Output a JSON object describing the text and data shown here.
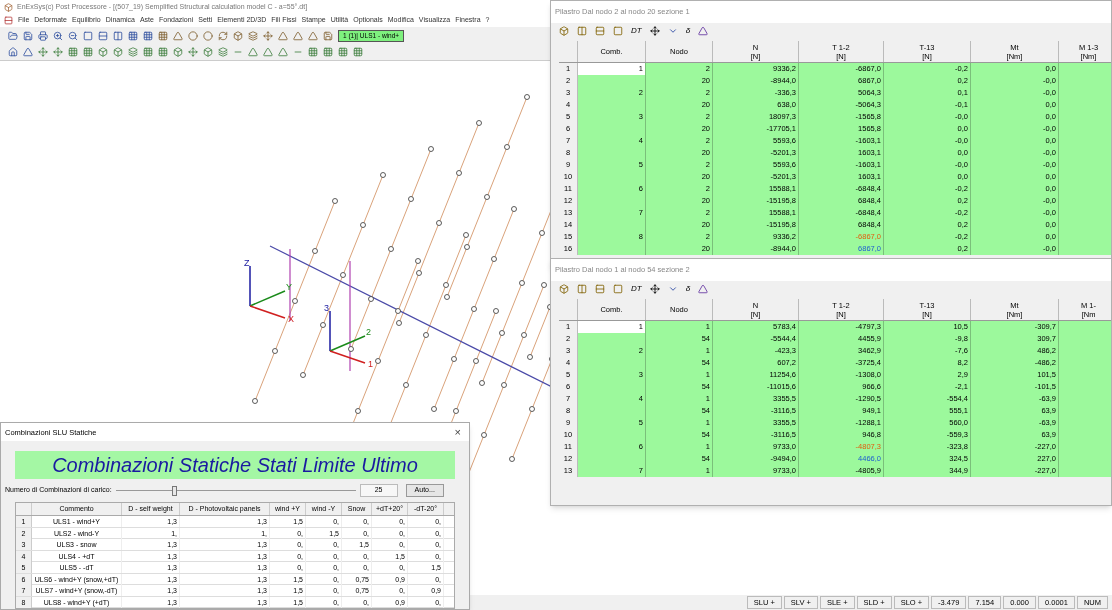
{
  "window": {
    "title": "EnExSys(c) Post Processore - [(507_19) Semplified Structural calculation model C - a=55°.dt]"
  },
  "menu": [
    "File",
    "Deformate",
    "Equilibrio",
    "Dinamica",
    "Aste",
    "Fondazioni",
    "Setti",
    "Elementi 2D/3D",
    "Fili Fissi",
    "Stampe",
    "Utilità",
    "Optionals",
    "Modifica",
    "Visualizza",
    "Finestra",
    "?"
  ],
  "combo_select": {
    "value": "1 (1)| ULS1 - wind+"
  },
  "axes_labels": [
    "Z",
    "Y",
    "X",
    "3",
    "2",
    "1"
  ],
  "result_windows": [
    {
      "title": "Pilastro Dal nodo 2 al nodo 20  sezione 1",
      "toolbar_texts": [
        "DT",
        "δ"
      ],
      "columns": [
        {
          "label": "Comb."
        },
        {
          "label": "Nodo"
        },
        {
          "label": "N",
          "unit": "[N]"
        },
        {
          "label": "T 1-2",
          "unit": "[N]"
        },
        {
          "label": "T-13",
          "unit": "[N]"
        },
        {
          "label": "Mt",
          "unit": "[Nm]"
        },
        {
          "label": "M 1-3",
          "unit": "[Nm]"
        }
      ],
      "rows": [
        {
          "num": "1",
          "cells": [
            "1",
            "2",
            "9336,2",
            "-6867,0",
            "-0,2",
            "0,0"
          ],
          "min": false,
          "max": false,
          "selected": true
        },
        {
          "num": "2",
          "cells": [
            "",
            "20",
            "-8944,0",
            "6867,0",
            "0,2",
            "-0,0"
          ],
          "min": false,
          "max": false,
          "selected": false
        },
        {
          "num": "3",
          "cells": [
            "2",
            "2",
            "-336,3",
            "5064,3",
            "0,1",
            "-0,0"
          ],
          "min": false,
          "max": false,
          "selected": false
        },
        {
          "num": "4",
          "cells": [
            "",
            "20",
            "638,0",
            "-5064,3",
            "-0,1",
            "0,0"
          ],
          "min": false,
          "max": false,
          "selected": false
        },
        {
          "num": "5",
          "cells": [
            "3",
            "2",
            "18097,3",
            "-1565,8",
            "-0,0",
            "0,0"
          ],
          "min": false,
          "max": false,
          "selected": false
        },
        {
          "num": "6",
          "cells": [
            "",
            "20",
            "-17705,1",
            "1565,8",
            "0,0",
            "-0,0"
          ],
          "min": false,
          "max": false,
          "selected": false
        },
        {
          "num": "7",
          "cells": [
            "4",
            "2",
            "5593,6",
            "-1603,1",
            "-0,0",
            "0,0"
          ],
          "min": false,
          "max": false,
          "selected": false
        },
        {
          "num": "8",
          "cells": [
            "",
            "20",
            "-5201,3",
            "1603,1",
            "0,0",
            "-0,0"
          ],
          "min": false,
          "max": false,
          "selected": false
        },
        {
          "num": "9",
          "cells": [
            "5",
            "2",
            "5593,6",
            "-1603,1",
            "-0,0",
            "-0,0"
          ],
          "min": false,
          "max": false,
          "selected": false
        },
        {
          "num": "10",
          "cells": [
            "",
            "20",
            "-5201,3",
            "1603,1",
            "0,0",
            "0,0"
          ],
          "min": false,
          "max": false,
          "selected": false
        },
        {
          "num": "11",
          "cells": [
            "6",
            "2",
            "15588,1",
            "-6848,4",
            "-0,2",
            "0,0"
          ],
          "min": false,
          "max": false,
          "selected": false
        },
        {
          "num": "12",
          "cells": [
            "",
            "20",
            "-15195,8",
            "6848,4",
            "0,2",
            "-0,0"
          ],
          "min": false,
          "max": false,
          "selected": false
        },
        {
          "num": "13",
          "cells": [
            "7",
            "2",
            "15588,1",
            "-6848,4",
            "-0,2",
            "-0,0"
          ],
          "min": false,
          "max": false,
          "selected": false
        },
        {
          "num": "14",
          "cells": [
            "",
            "20",
            "-15195,8",
            "6848,4",
            "0,2",
            "0,0"
          ],
          "min": false,
          "max": false,
          "selected": false
        },
        {
          "num": "15",
          "cells": [
            "8",
            "2",
            "9336,2",
            "-6867,0",
            "-0,2",
            "0,0"
          ],
          "min": true,
          "max": false,
          "selected": false
        },
        {
          "num": "16",
          "cells": [
            "",
            "20",
            "-8944,0",
            "6867,0",
            "0,2",
            "-0,0"
          ],
          "min": false,
          "max": true,
          "selected": false
        }
      ]
    },
    {
      "title": "Pilastro Dal nodo 1 al nodo 54  sezione 2",
      "toolbar_texts": [
        "DT",
        "δ"
      ],
      "columns": [
        {
          "label": "Comb."
        },
        {
          "label": "Nodo"
        },
        {
          "label": "N",
          "unit": "[N]"
        },
        {
          "label": "T 1-2",
          "unit": "[N]"
        },
        {
          "label": "T-13",
          "unit": "[N]"
        },
        {
          "label": "Mt",
          "unit": "[Nm]"
        },
        {
          "label": "M 1-",
          "unit": "[Nm"
        }
      ],
      "rows": [
        {
          "num": "1",
          "cells": [
            "1",
            "1",
            "5783,4",
            "-4797,3",
            "10,5",
            "-309,7"
          ],
          "min": false,
          "max": false,
          "selected": true
        },
        {
          "num": "2",
          "cells": [
            "",
            "54",
            "-5544,4",
            "4455,9",
            "-9,8",
            "309,7"
          ],
          "min": false,
          "max": false,
          "selected": false
        },
        {
          "num": "3",
          "cells": [
            "2",
            "1",
            "-423,3",
            "3462,9",
            "-7,6",
            "486,2"
          ],
          "min": false,
          "max": false,
          "selected": false
        },
        {
          "num": "4",
          "cells": [
            "",
            "54",
            "607,2",
            "-3725,4",
            "8,2",
            "-486,2"
          ],
          "min": false,
          "max": false,
          "selected": false
        },
        {
          "num": "5",
          "cells": [
            "3",
            "1",
            "11254,6",
            "-1308,0",
            "2,9",
            "101,5"
          ],
          "min": false,
          "max": false,
          "selected": false
        },
        {
          "num": "6",
          "cells": [
            "",
            "54",
            "-11015,6",
            "966,6",
            "-2,1",
            "-101,5"
          ],
          "min": false,
          "max": false,
          "selected": false
        },
        {
          "num": "7",
          "cells": [
            "4",
            "1",
            "3355,5",
            "-1290,5",
            "-554,4",
            "-63,9"
          ],
          "min": false,
          "max": false,
          "selected": false
        },
        {
          "num": "8",
          "cells": [
            "",
            "54",
            "-3116,5",
            "949,1",
            "555,1",
            "63,9"
          ],
          "min": false,
          "max": false,
          "selected": false
        },
        {
          "num": "9",
          "cells": [
            "5",
            "1",
            "3355,5",
            "-1288,1",
            "560,0",
            "-63,9"
          ],
          "min": false,
          "max": false,
          "selected": false
        },
        {
          "num": "10",
          "cells": [
            "",
            "54",
            "-3116,5",
            "946,8",
            "-559,3",
            "63,9"
          ],
          "min": false,
          "max": false,
          "selected": false
        },
        {
          "num": "11",
          "cells": [
            "6",
            "1",
            "9733,0",
            "-4807,3",
            "-323,8",
            "-227,0"
          ],
          "min": true,
          "max": false,
          "selected": false
        },
        {
          "num": "12",
          "cells": [
            "",
            "54",
            "-9494,0",
            "4466,0",
            "324,5",
            "227,0"
          ],
          "min": false,
          "max": true,
          "selected": false
        },
        {
          "num": "13",
          "cells": [
            "7",
            "1",
            "9733,0",
            "-4805,9",
            "344,9",
            "-227,0"
          ],
          "min": false,
          "max": false,
          "selected": false
        }
      ]
    }
  ],
  "dialog": {
    "title": "Combinazioni SLU Statiche",
    "close": "×",
    "banner": "Combinazioni Statiche Stati Limite Ultimo",
    "slider_label": "Numero di Combinazioni di carico:",
    "slider": {
      "level": 0.24
    },
    "count": "25",
    "auto_button": "Auto...",
    "columns": [
      "Commento",
      "D - self weight",
      "D - Photovoltaic panels",
      "wind +Y",
      "wind -Y",
      "Snow",
      "+dT+20°",
      "-dT-20°"
    ],
    "rows": [
      {
        "num": "1",
        "cells": [
          "ULS1 - wind+Y",
          "1,3",
          "1,3",
          "1,5",
          "0,",
          "0,",
          "0,",
          "0,"
        ]
      },
      {
        "num": "2",
        "cells": [
          "ULS2 - wind-Y",
          "1,",
          "1,",
          "0,",
          "1,5",
          "0,",
          "0,",
          "0,"
        ]
      },
      {
        "num": "3",
        "cells": [
          "ULS3 - snow",
          "1,3",
          "1,3",
          "0,",
          "0,",
          "1,5",
          "0,",
          "0,"
        ]
      },
      {
        "num": "4",
        "cells": [
          "ULS4 - +dT",
          "1,3",
          "1,3",
          "0,",
          "0,",
          "0,",
          "1,5",
          "0,"
        ]
      },
      {
        "num": "5",
        "cells": [
          "ULS5 - -dT",
          "1,3",
          "1,3",
          "0,",
          "0,",
          "0,",
          "0,",
          "1,5"
        ]
      },
      {
        "num": "6",
        "cells": [
          "ULS6 - wind+Y (snow,+dT)",
          "1,3",
          "1,3",
          "1,5",
          "0,",
          "0,75",
          "0,9",
          "0,"
        ]
      },
      {
        "num": "7",
        "cells": [
          "ULS7 - wind+Y (snow,-dT)",
          "1,3",
          "1,3",
          "1,5",
          "0,",
          "0,75",
          "0,",
          "0,9"
        ]
      },
      {
        "num": "8",
        "cells": [
          "ULS8 - wind+Y (+dT)",
          "1,3",
          "1,3",
          "1,5",
          "0,",
          "0,",
          "0,9",
          "0,"
        ]
      }
    ]
  },
  "status_bar": [
    "SLU +",
    "SLV +",
    "SLE +",
    "SLD +",
    "SLO +",
    "-3.479",
    "7.154",
    "0.000",
    "0.0001",
    "NUM"
  ]
}
